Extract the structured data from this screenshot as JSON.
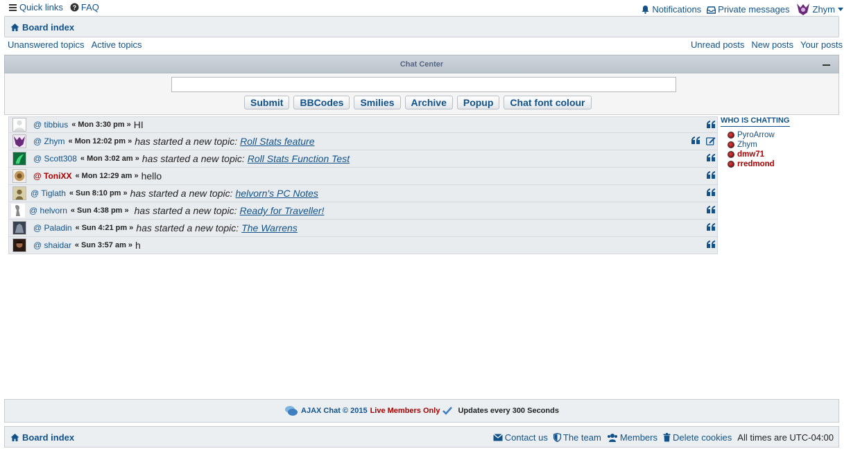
{
  "topnav": {
    "quick_links": "Quick links",
    "faq": "FAQ",
    "notifications": "Notifications",
    "private_messages": "Private messages",
    "username": "Zhym"
  },
  "breadcrumb": {
    "board_index": "Board index"
  },
  "quick_left": {
    "unanswered": "Unanswered topics",
    "active": "Active topics"
  },
  "quick_right": {
    "unread": "Unread posts",
    "new": "New posts",
    "yours": "Your posts"
  },
  "chat": {
    "title": "Chat Center",
    "buttons": {
      "submit": "Submit",
      "bbcodes": "BBCodes",
      "smilies": "Smilies",
      "archive": "Archive",
      "popup": "Popup",
      "font_colour": "Chat font colour"
    },
    "messages": [
      {
        "user": "@ tibbius",
        "time": "« Mon 3:30 pm »",
        "text": "HI",
        "topic": ""
      },
      {
        "user": "@ Zhym",
        "time": "« Mon 12:02 pm »",
        "text": "has started a new topic:",
        "topic": "Roll Stats feature"
      },
      {
        "user": "@ Scott308",
        "time": "« Mon 3:02 am »",
        "text": "has started a new topic:",
        "topic": "Roll Stats Function Test"
      },
      {
        "user": "@ ToniXX",
        "time": "« Mon 12:29 am »",
        "text": "hello",
        "topic": ""
      },
      {
        "user": "@ Tiglath",
        "time": "« Sun 8:10 pm »",
        "text": "has started a new topic:",
        "topic": "helvorn's PC Notes"
      },
      {
        "user": "@ helvorn",
        "time": "« Sun 4:38 pm »",
        "text": "has started a new topic:",
        "topic": "Ready for Traveller!"
      },
      {
        "user": "@ Paladin",
        "time": "« Sun 4:21 pm »",
        "text": "has started a new topic:",
        "topic": "The Warrens"
      },
      {
        "user": "@ shaidar",
        "time": "« Sun 3:57 am »",
        "text": "h",
        "topic": ""
      }
    ],
    "who_title": "WHO IS CHATTING",
    "who": [
      "PyroArrow",
      "Zhym",
      "dmw71",
      "rredmond"
    ]
  },
  "chat_footer": {
    "ajax": "AJAX Chat © 2015",
    "live": "Live Members Only",
    "updates": "Updates every 300 Seconds"
  },
  "footer": {
    "board_index": "Board index",
    "contact": "Contact us",
    "team": "The team",
    "members": "Members",
    "delete_cookies": "Delete cookies",
    "times": "All times are UTC-04:00"
  },
  "colors": {
    "link": "#105289",
    "highlight": "#aa0000"
  }
}
